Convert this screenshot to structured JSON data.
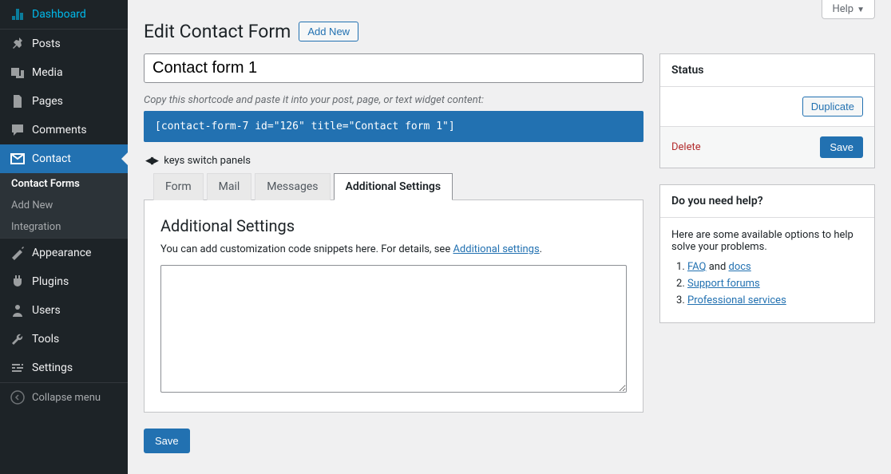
{
  "sidebar": {
    "items": [
      {
        "label": "Dashboard",
        "icon": "dashboard"
      },
      {
        "label": "Posts",
        "icon": "pin"
      },
      {
        "label": "Media",
        "icon": "media"
      },
      {
        "label": "Pages",
        "icon": "pages"
      },
      {
        "label": "Comments",
        "icon": "comments"
      },
      {
        "label": "Contact",
        "icon": "mail"
      },
      {
        "label": "Appearance",
        "icon": "appearance"
      },
      {
        "label": "Plugins",
        "icon": "plugins"
      },
      {
        "label": "Users",
        "icon": "users"
      },
      {
        "label": "Tools",
        "icon": "tools"
      },
      {
        "label": "Settings",
        "icon": "settings"
      }
    ],
    "submenu": [
      {
        "label": "Contact Forms"
      },
      {
        "label": "Add New"
      },
      {
        "label": "Integration"
      }
    ],
    "collapse": "Collapse menu"
  },
  "help_tab": "Help",
  "page": {
    "title": "Edit Contact Form",
    "add_new": "Add New",
    "form_title": "Contact form 1",
    "shortcode_hint": "Copy this shortcode and paste it into your post, page, or text widget content:",
    "shortcode": "[contact-form-7 id=\"126\" title=\"Contact form 1\"]",
    "keys_hint": "keys switch panels",
    "tabs": [
      "Form",
      "Mail",
      "Messages",
      "Additional Settings"
    ],
    "panel": {
      "heading": "Additional Settings",
      "desc_prefix": "You can add customization code snippets here. For details, see ",
      "desc_link": "Additional settings",
      "desc_suffix": "."
    },
    "save": "Save"
  },
  "status_box": {
    "title": "Status",
    "duplicate": "Duplicate",
    "delete": "Delete",
    "save": "Save"
  },
  "help_box": {
    "title": "Do you need help?",
    "intro": "Here are some available options to help solve your problems.",
    "faq": "FAQ",
    "and": " and ",
    "docs": "docs",
    "forums": "Support forums",
    "pro": "Professional services"
  }
}
